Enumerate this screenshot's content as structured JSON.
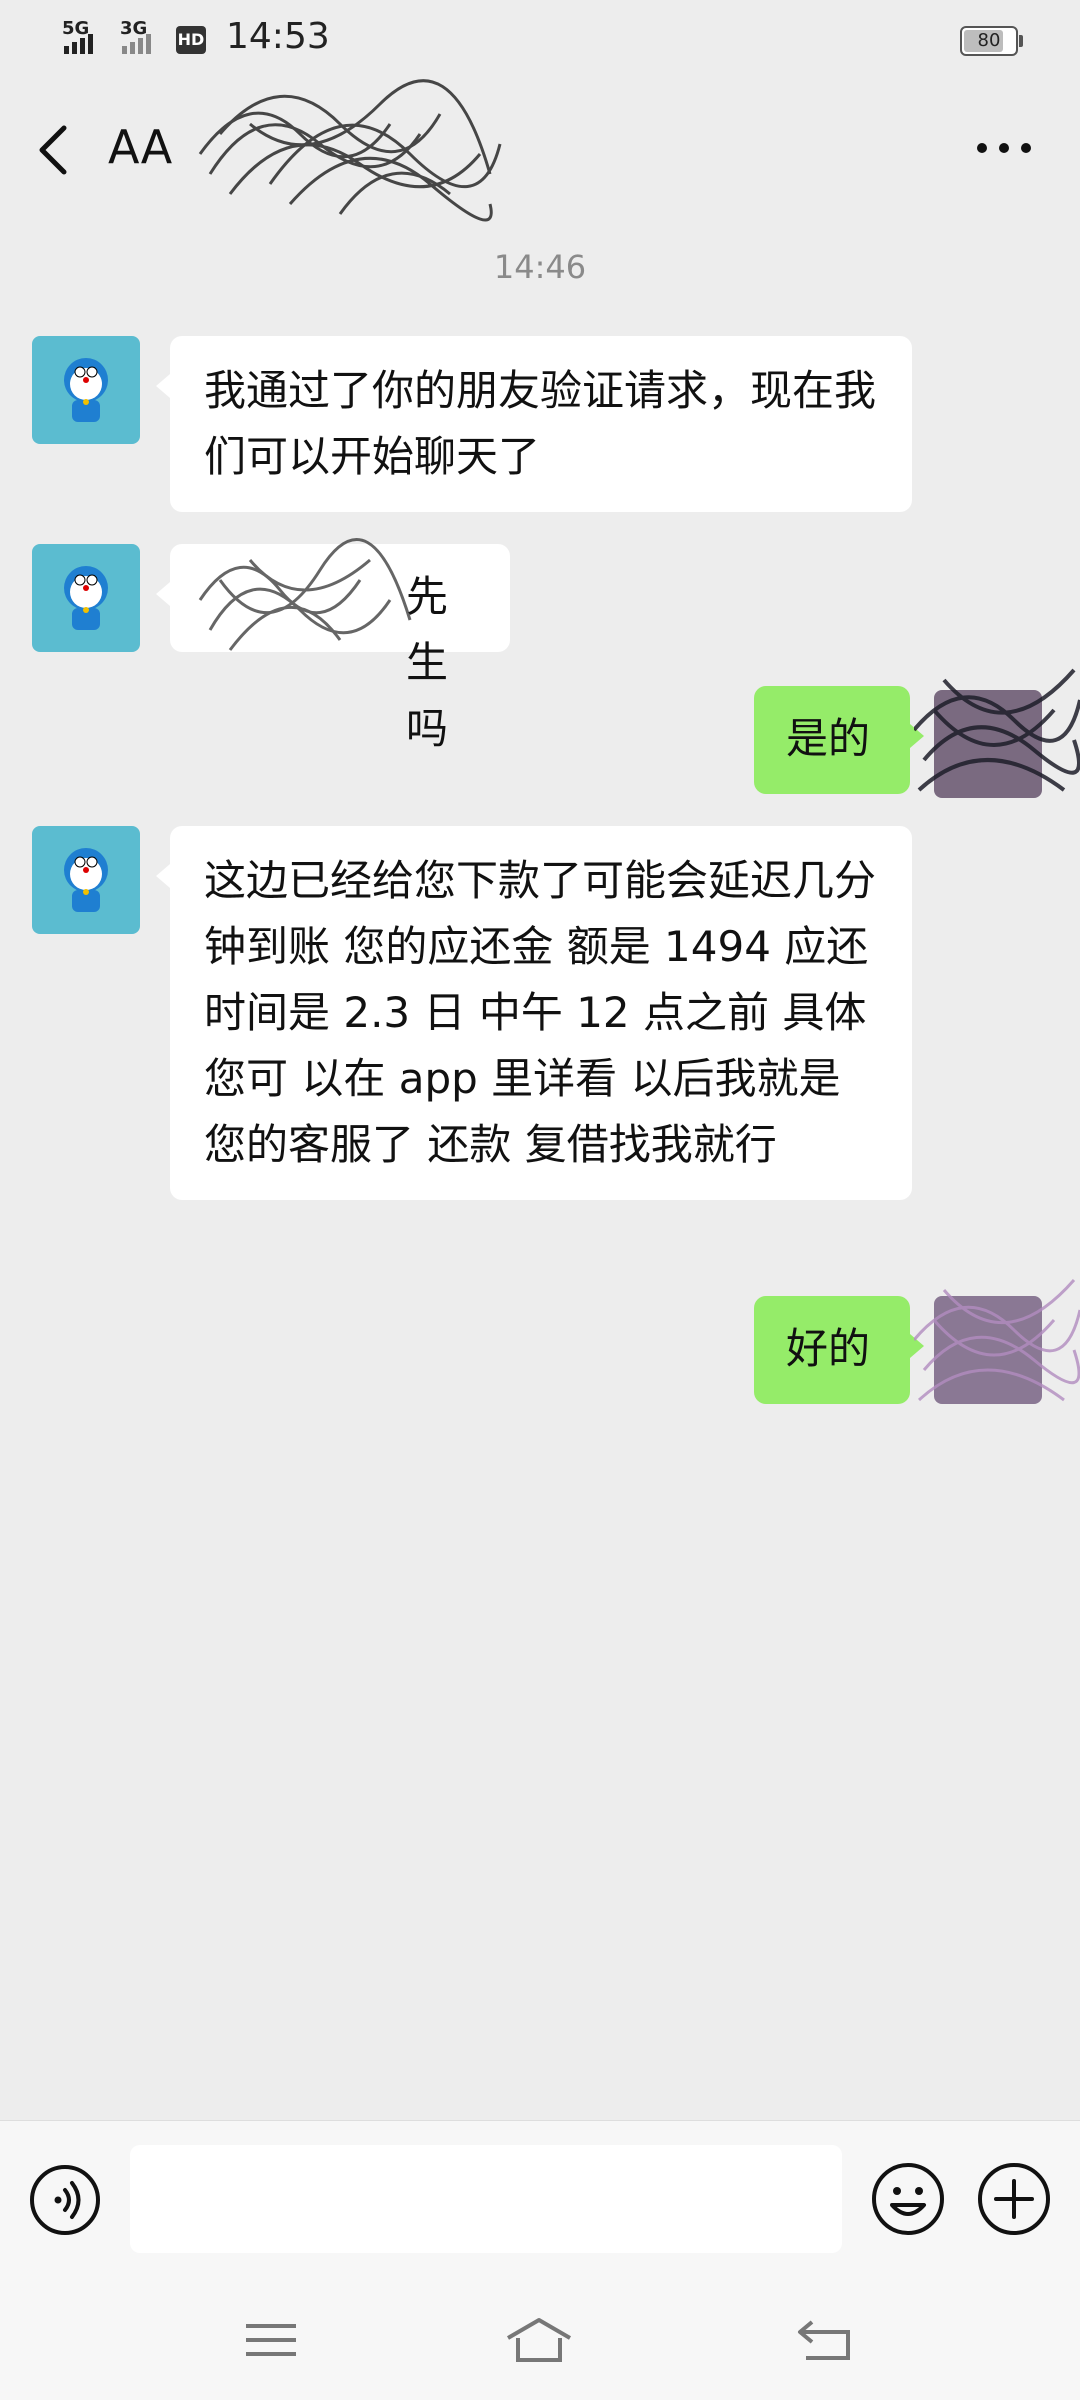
{
  "status_bar": {
    "network_1": "5G",
    "network_2": "3G",
    "hd": "HD",
    "time": "14:53",
    "battery": "80",
    "battery_level": 0.8
  },
  "header": {
    "back_icon": "chevron-left-icon",
    "title": "AA",
    "more_icon": "more-dots-icon"
  },
  "chat": {
    "timestamp": "14:46",
    "messages": [
      {
        "side": "in",
        "text": "我通过了你的朋友验证请求，现在我们可以开始聊天了"
      },
      {
        "side": "in",
        "text": "是***先生吗",
        "visible_text": "先生吗"
      },
      {
        "side": "out",
        "text": "是的"
      },
      {
        "side": "in",
        "text": "这边已经给您下款了可能会延迟几分钟到账  您的应还金 额是 1494 应还时间是 2.3 日 中午 12 点之前 具体 您可 以在 app 里详看 以后我就是您的客服了 还款 复借找我就行"
      },
      {
        "side": "out",
        "text": "好的"
      }
    ]
  },
  "input_bar": {
    "voice_icon": "voice-icon",
    "placeholder": "",
    "emoji_icon": "emoji-icon",
    "plus_icon": "plus-icon"
  },
  "nav_bar": {
    "menu_icon": "menu-icon",
    "home_icon": "home-icon",
    "back_icon": "back-arrow-icon"
  },
  "colors": {
    "background": "#ededed",
    "incoming_bubble": "#ffffff",
    "outgoing_bubble": "#95ec69",
    "avatar_bg": "#5bbcd0"
  }
}
